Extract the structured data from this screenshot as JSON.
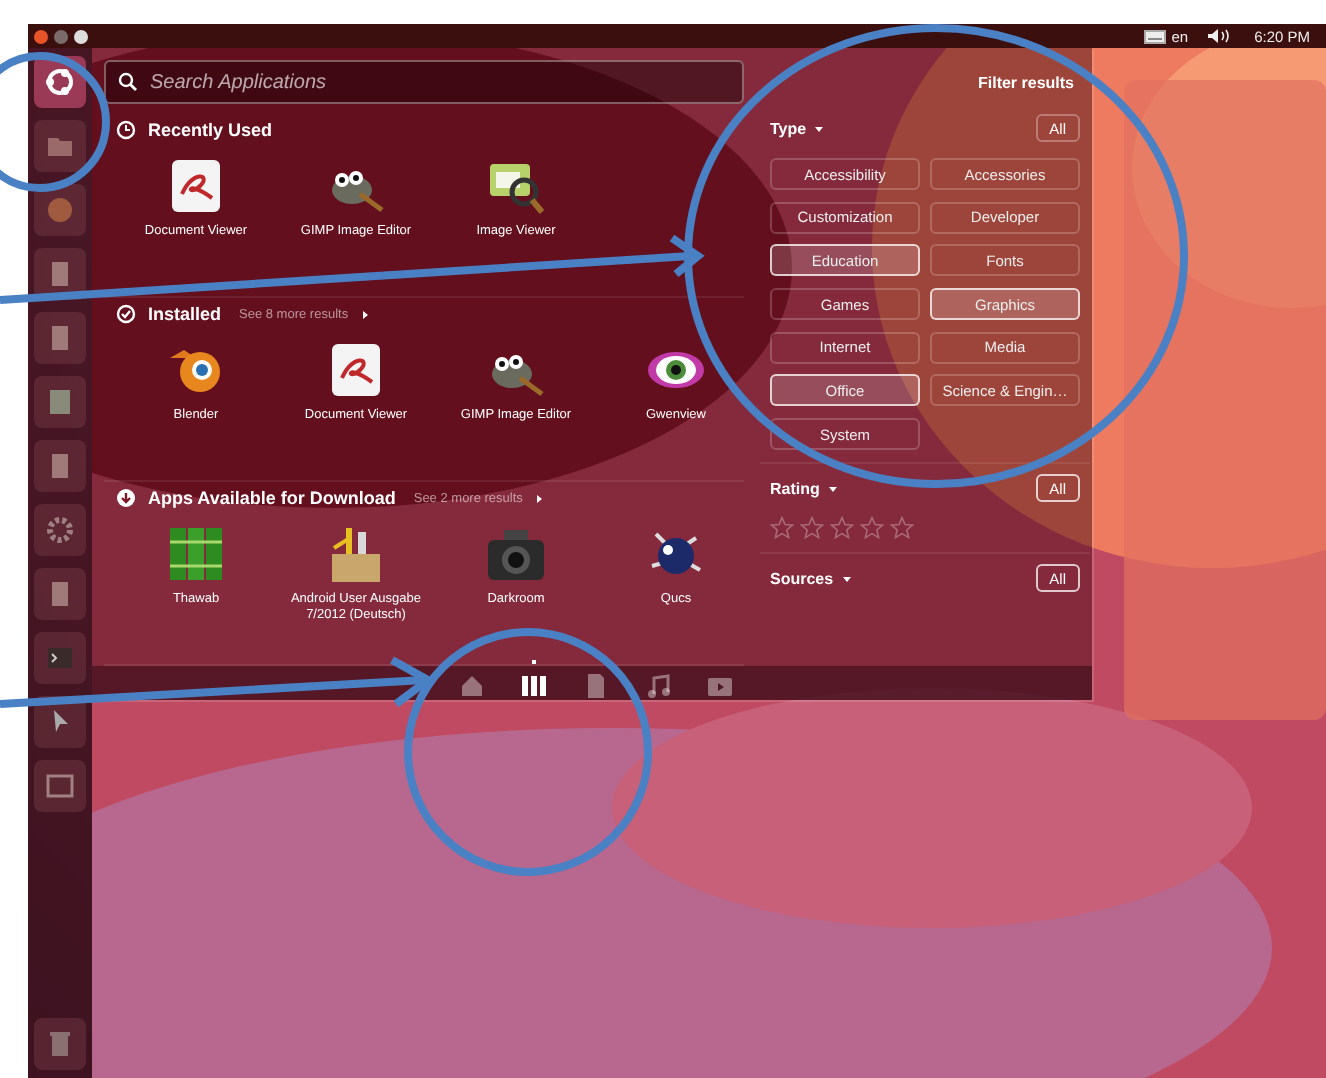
{
  "top_panel": {
    "keyboard_layout": "en",
    "clock": "6:20 PM"
  },
  "search": {
    "placeholder": "Search Applications"
  },
  "sections": [
    {
      "kind": "recent",
      "title": "Recently Used",
      "apps": [
        {
          "name": "Document Viewer",
          "kind": "document"
        },
        {
          "name": "GIMP Image Editor",
          "kind": "gimp"
        },
        {
          "name": "Image Viewer"
        }
      ]
    },
    {
      "kind": "installed",
      "title": "Installed",
      "more": "See 8 more results",
      "apps": [
        {
          "name": "Blender",
          "kind": "blender"
        },
        {
          "name": "Document Viewer",
          "kind": "document"
        },
        {
          "name": "GIMP Image Editor",
          "kind": "gimp"
        },
        {
          "name": "Gwenview",
          "kind": "eye"
        }
      ]
    },
    {
      "kind": "download",
      "title": "Apps Available for Download",
      "more": "See 2 more results",
      "apps": [
        {
          "name": "Thawab",
          "kind": "books"
        },
        {
          "name": "Android User Ausgabe 7/2012 (Deutsch)",
          "kind": "tools"
        },
        {
          "name": "Darkroom",
          "kind": "camera"
        },
        {
          "name": "Qucs",
          "kind": "bug"
        }
      ]
    }
  ],
  "filters": {
    "title": "Filter results",
    "groups": [
      {
        "kind": "buttons",
        "label": "Type",
        "all": "All",
        "options": [
          {
            "label": "Accessibility",
            "selected": false
          },
          {
            "label": "Accessories",
            "selected": false
          },
          {
            "label": "Customization",
            "selected": false
          },
          {
            "label": "Developer",
            "selected": false
          },
          {
            "label": "Education",
            "selected": true
          },
          {
            "label": "Fonts",
            "selected": false
          },
          {
            "label": "Games",
            "selected": false
          },
          {
            "label": "Graphics",
            "selected": true
          },
          {
            "label": "Internet",
            "selected": false
          },
          {
            "label": "Media",
            "selected": false
          },
          {
            "label": "Office",
            "selected": true
          },
          {
            "label": "Science & Engin…",
            "selected": false
          },
          {
            "label": "System",
            "selected": false
          }
        ]
      },
      {
        "kind": "stars",
        "label": "Rating",
        "all": "All",
        "stars": 0
      },
      {
        "kind": "collapsed",
        "label": "Sources",
        "all": "All"
      }
    ]
  },
  "lens_bar": {
    "lenses": [
      {
        "kind": "home",
        "selected": false
      },
      {
        "kind": "apps",
        "selected": true
      },
      {
        "kind": "files",
        "selected": false
      },
      {
        "kind": "music",
        "selected": false
      },
      {
        "kind": "video",
        "selected": false
      }
    ]
  }
}
